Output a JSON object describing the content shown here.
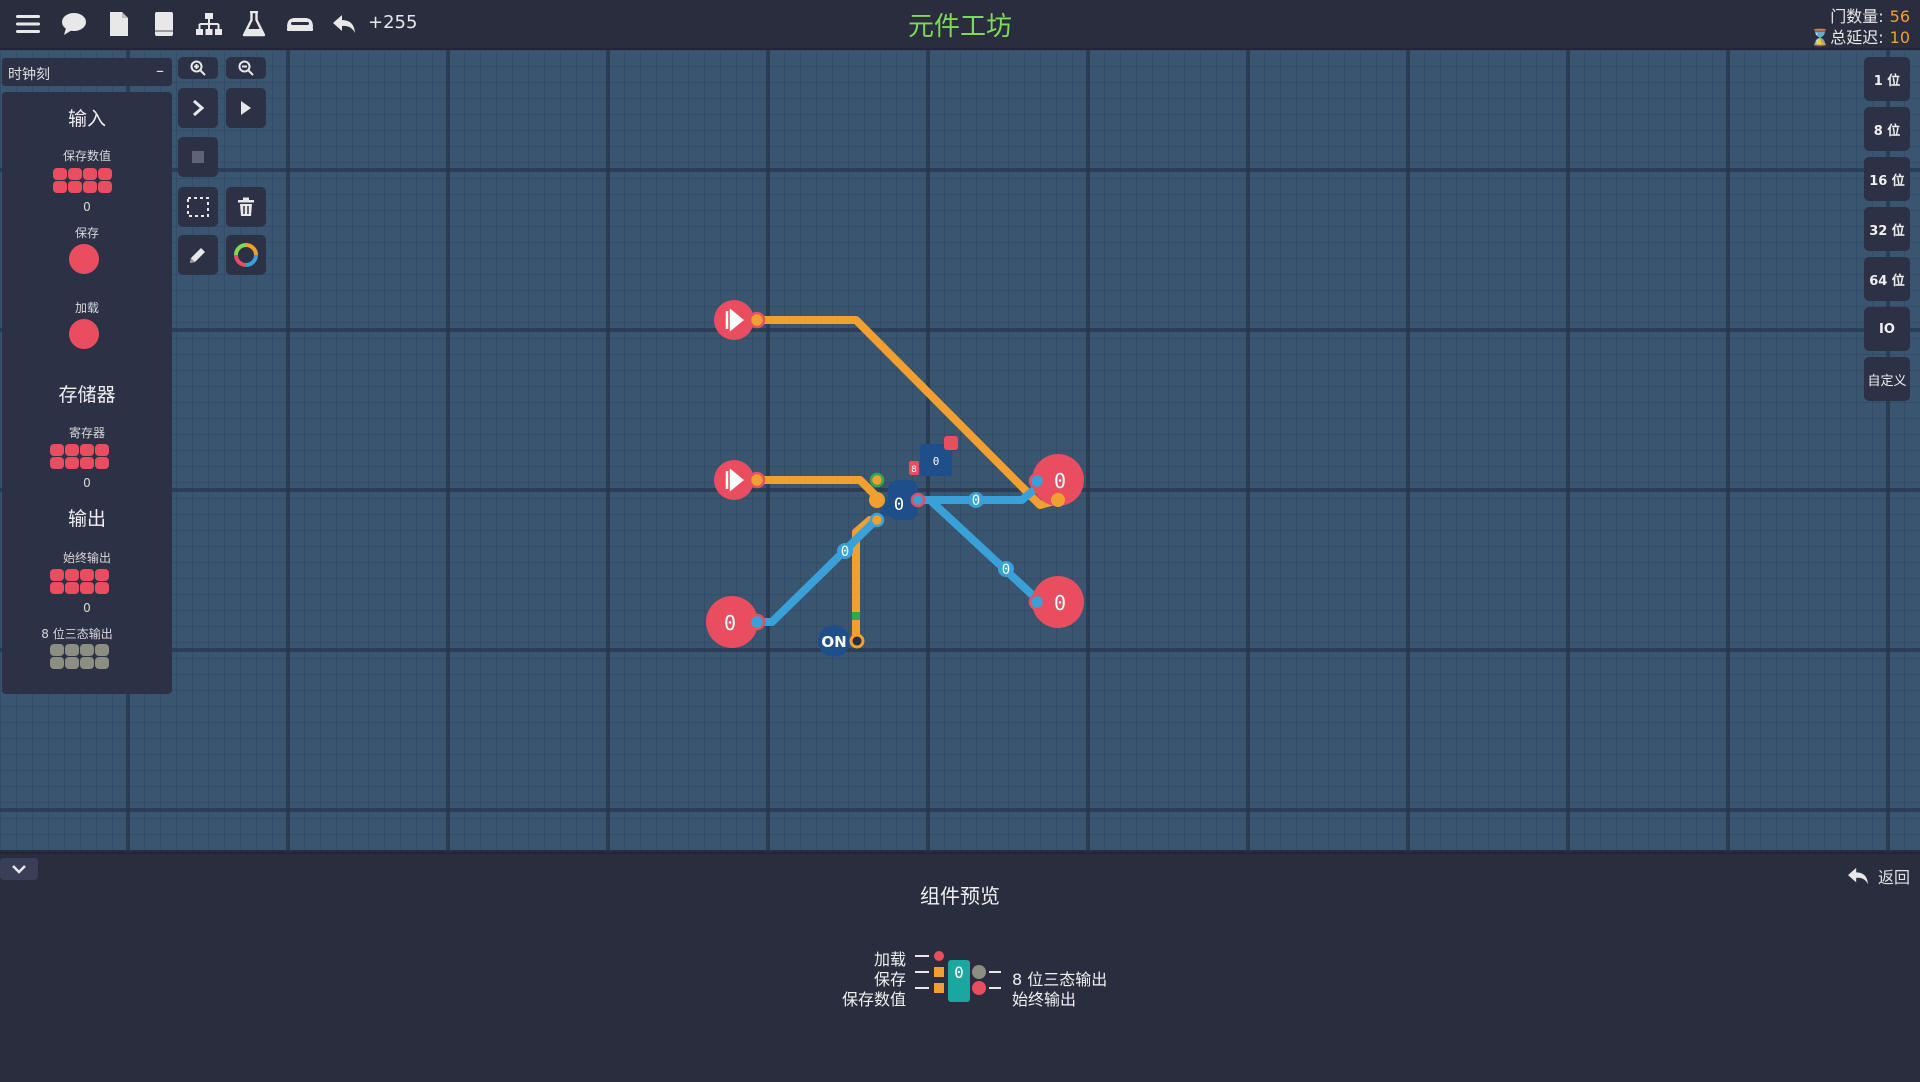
{
  "header": {
    "title": "元件工坊",
    "undo_count": "+255",
    "gate_count_label": "门数量:",
    "gate_count_value": "56",
    "delay_label": "总延迟:",
    "delay_value": "10"
  },
  "palette": {
    "category": "时钟刻",
    "collapse_symbol": "–",
    "sections": {
      "input": "输入",
      "memory": "存储器",
      "output": "输出"
    },
    "items": {
      "save_value": {
        "label": "保存数值",
        "value": "0"
      },
      "save": {
        "label": "保存"
      },
      "load": {
        "label": "加载"
      },
      "register": {
        "label": "寄存器",
        "value": "0"
      },
      "always_output": {
        "label": "始终输出",
        "value": "0"
      },
      "tristate_output": {
        "label": "8 位三态输出"
      }
    }
  },
  "bit_selector": [
    "1 位",
    "8 位",
    "16 位",
    "32 位",
    "64 位",
    "IO",
    "自定义"
  ],
  "circuit": {
    "pin_values": [
      "0",
      "0",
      "0"
    ],
    "register_value": "0",
    "register_small_value": "0",
    "register_tag": "8",
    "wire_values": [
      "0",
      "0",
      "0",
      "0"
    ],
    "switch_label": "ON"
  },
  "bottom": {
    "title": "组件预览",
    "back_label": "返回",
    "preview": {
      "chip_value": "0",
      "inputs": [
        "加载",
        "保存",
        "保存数值"
      ],
      "outputs": [
        "8 位三态输出",
        "始终输出"
      ]
    }
  },
  "colors": {
    "accent_green": "#7ed957",
    "stat_orange": "#f0a030",
    "pin_red": "#e84d60",
    "wire_orange": "#f0a030",
    "wire_blue": "#3aa0d8",
    "canvas_bg": "#3a5570"
  }
}
